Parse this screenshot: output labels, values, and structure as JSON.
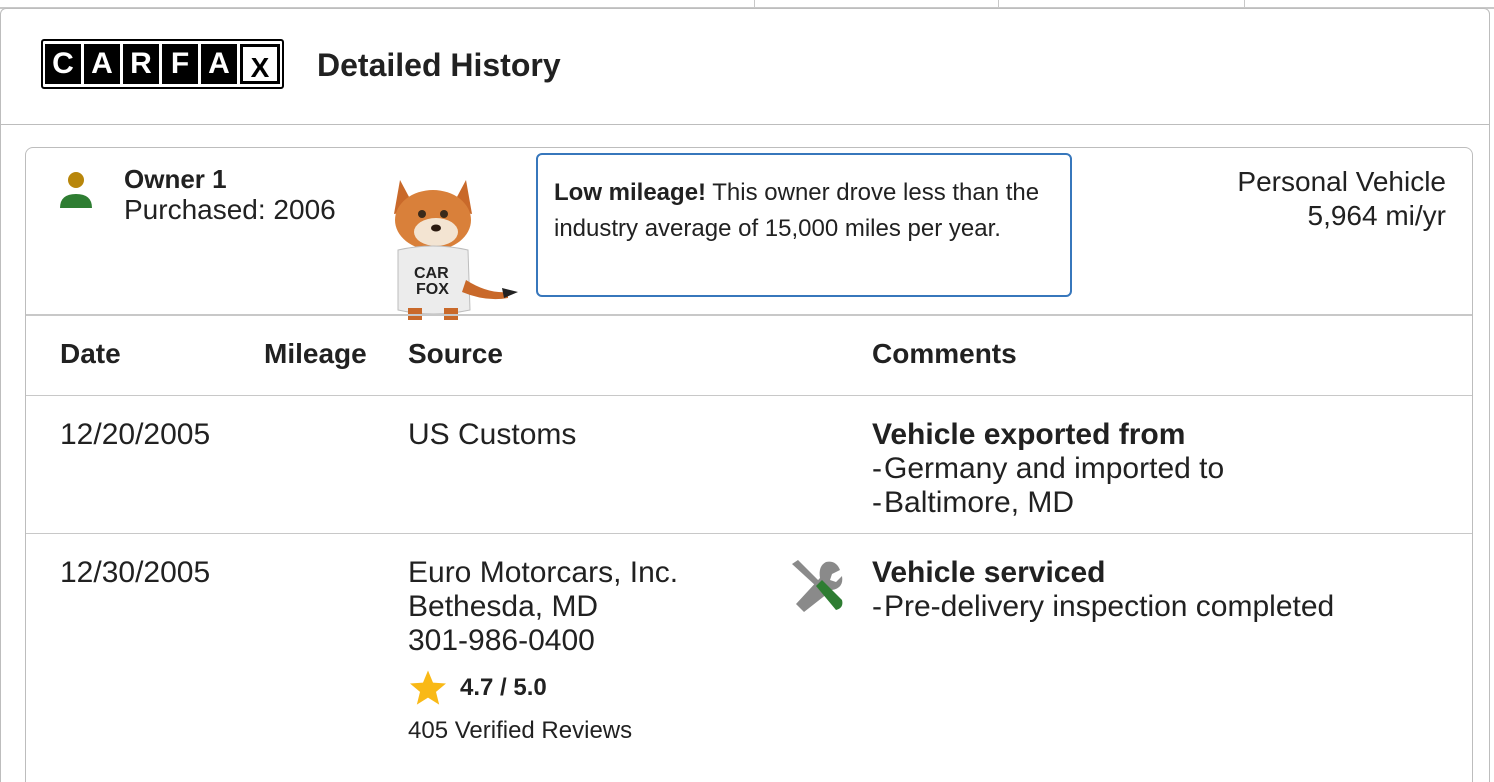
{
  "header": {
    "logo_letters": [
      "C",
      "A",
      "R",
      "F",
      "A",
      "X"
    ],
    "title": "Detailed History"
  },
  "owner": {
    "name": "Owner 1",
    "purchased": "Purchased: 2006",
    "icon": "person-icon",
    "icon_head_color": "#b8860b",
    "icon_body_color": "#2e7d32"
  },
  "tip": {
    "bold": "Low mileage!",
    "text": " This owner drove less than the industry average of 15,000 miles per year.",
    "border_color": "#3777bc"
  },
  "vehicle": {
    "type": "Personal Vehicle",
    "miles_per_year": "5,964 mi/yr"
  },
  "table": {
    "headers": {
      "date": "Date",
      "mileage": "Mileage",
      "source": "Source",
      "comments": "Comments"
    },
    "rows": [
      {
        "date": "12/20/2005",
        "mileage": "",
        "source_lines": [
          "US Customs"
        ],
        "comment_title": "Vehicle exported from",
        "comment_lines": [
          "Germany and imported to",
          "Baltimore, MD"
        ]
      },
      {
        "date": "12/30/2005",
        "mileage": "",
        "source_lines": [
          "Euro Motorcars, Inc.",
          "Bethesda, MD",
          "301-986-0400"
        ],
        "rating": "4.7 / 5.0",
        "reviews": "405 Verified Reviews",
        "service_icon": "wrench-screwdriver-icon",
        "comment_title": "Vehicle serviced",
        "comment_lines": [
          "Pre-delivery inspection completed"
        ]
      }
    ]
  },
  "colors": {
    "star": "#f9b916",
    "service_icon_gray": "#8a8a8a",
    "service_icon_green": "#2e7d32"
  }
}
